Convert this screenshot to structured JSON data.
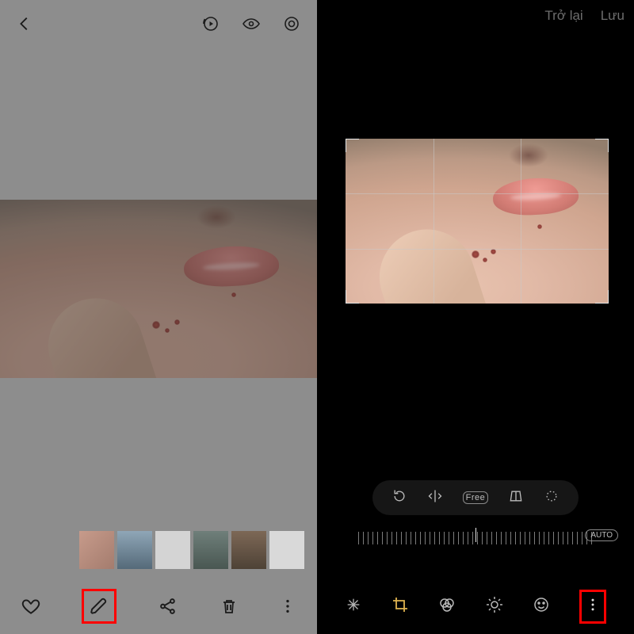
{
  "left": {
    "topbar": {
      "back_icon": "back-chevron",
      "actions": [
        "motion-photo",
        "eye-visibility",
        "bixby-lens"
      ]
    },
    "bottom": {
      "heart": "favorite-icon",
      "edit": "edit-pencil-icon",
      "share": "share-icon",
      "trash": "trash-icon",
      "more": "more-vertical-icon"
    },
    "thumbnails_count": 6
  },
  "right": {
    "header": {
      "back_label": "Trở lại",
      "save_label": "Lưu"
    },
    "crop_tools_pill": [
      "rotate-ccw-icon",
      "flip-horizontal-icon",
      "ratio-free-icon",
      "perspective-icon",
      "lasso-icon"
    ],
    "ratio_free_text": "Free",
    "ruler": {
      "auto_label": "AUTO"
    },
    "bottom_tools": [
      "magic-wand-icon",
      "crop-icon",
      "filters-icon",
      "brightness-icon",
      "sticker-icon",
      "more-vertical-icon"
    ]
  },
  "highlights": {
    "left_edit": true,
    "right_more": true
  }
}
